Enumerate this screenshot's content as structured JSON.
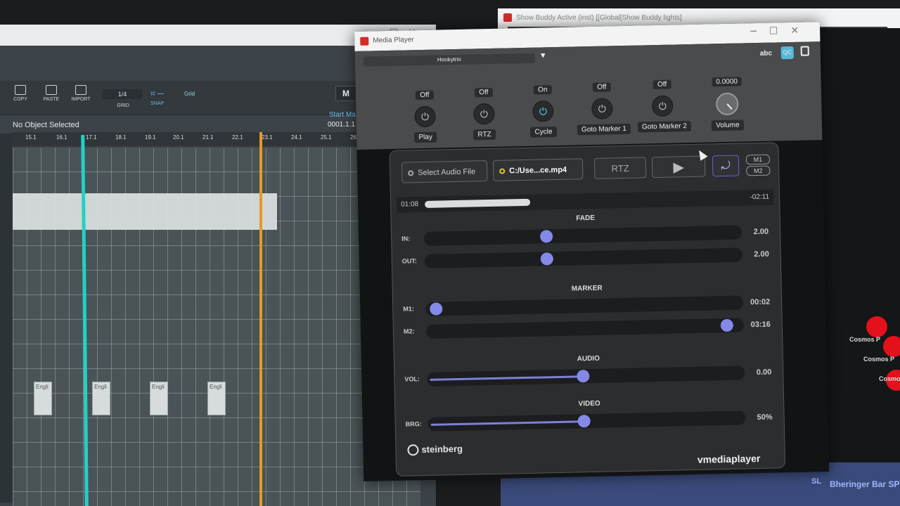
{
  "daw": {
    "toolbar": {
      "copy": "COPY",
      "paste": "PASTE",
      "import": "IMPORT",
      "grid_value": "1/4",
      "grid": "GRID",
      "snap": "SNAP",
      "grid_mode": "Grid",
      "m_button": "M"
    },
    "start_marker_label": "Start Ma",
    "start_marker_value": "0001.1.1",
    "no_object": "No Object Selected",
    "ruler": [
      "15.1",
      "16.1",
      "17.1",
      "18.1",
      "19.1",
      "20.1",
      "21.1",
      "22.1",
      "23.1",
      "24.1",
      "25.1",
      "26"
    ],
    "clips": [
      "Engli",
      "Engli",
      "Engli",
      "Engli"
    ],
    "colors": {
      "playhead": "#22d1c6",
      "loop": "#e8972b"
    }
  },
  "show_buddy": {
    "title": "Show Buddy Active (inst) [[Global[Show Buddy lights]",
    "play_glyph": "|>",
    "nodes": [
      "Cosmos P",
      "Cosmos P",
      "Cosmo"
    ],
    "bottom_labels": [
      "SL",
      "Bheringer Bar SP"
    ]
  },
  "media_player": {
    "title": "Media Player",
    "preset": "Honkytrio",
    "abc": "abc",
    "qc": "QC",
    "controls": [
      {
        "state": "Off",
        "name": "Play",
        "on": false
      },
      {
        "state": "Off",
        "name": "RTZ",
        "on": false
      },
      {
        "state": "On",
        "name": "Cycle",
        "on": true
      },
      {
        "state": "Off",
        "name": "Goto Marker 1",
        "on": false
      },
      {
        "state": "Off",
        "name": "Goto Marker 2",
        "on": false
      }
    ],
    "volume": {
      "value": "0.0000",
      "name": "Volume"
    },
    "panel": {
      "select_audio": "Select Audio File",
      "file": "C:/Use...ce.mp4",
      "rtz": "RTZ",
      "play_glyph": "▶",
      "loop_glyph": "⤾",
      "m1": "M1",
      "m2": "M2",
      "time_elapsed": "01:08",
      "time_remaining": "-02:11",
      "position_fraction": 0.34,
      "sections": {
        "fade": "FADE",
        "marker": "MARKER",
        "audio": "AUDIO",
        "video": "VIDEO"
      },
      "fade_in": {
        "label": "IN:",
        "value": "2.00",
        "fraction": 0.38
      },
      "fade_out": {
        "label": "OUT:",
        "value": "2.00",
        "fraction": 0.38
      },
      "m1_slider": {
        "label": "M1:",
        "value": "00:02",
        "fraction": 0.01
      },
      "m2_slider": {
        "label": "M2:",
        "value": "03:16",
        "fraction": 0.97
      },
      "vol_slider": {
        "label": "VOL:",
        "value": "0.00",
        "fraction": 0.49
      },
      "brg_slider": {
        "label": "BRG:",
        "value": "50%",
        "fraction": 0.49
      },
      "brand": "steinberg",
      "product": "vmediaplayer"
    },
    "accent": "#8489e8"
  }
}
